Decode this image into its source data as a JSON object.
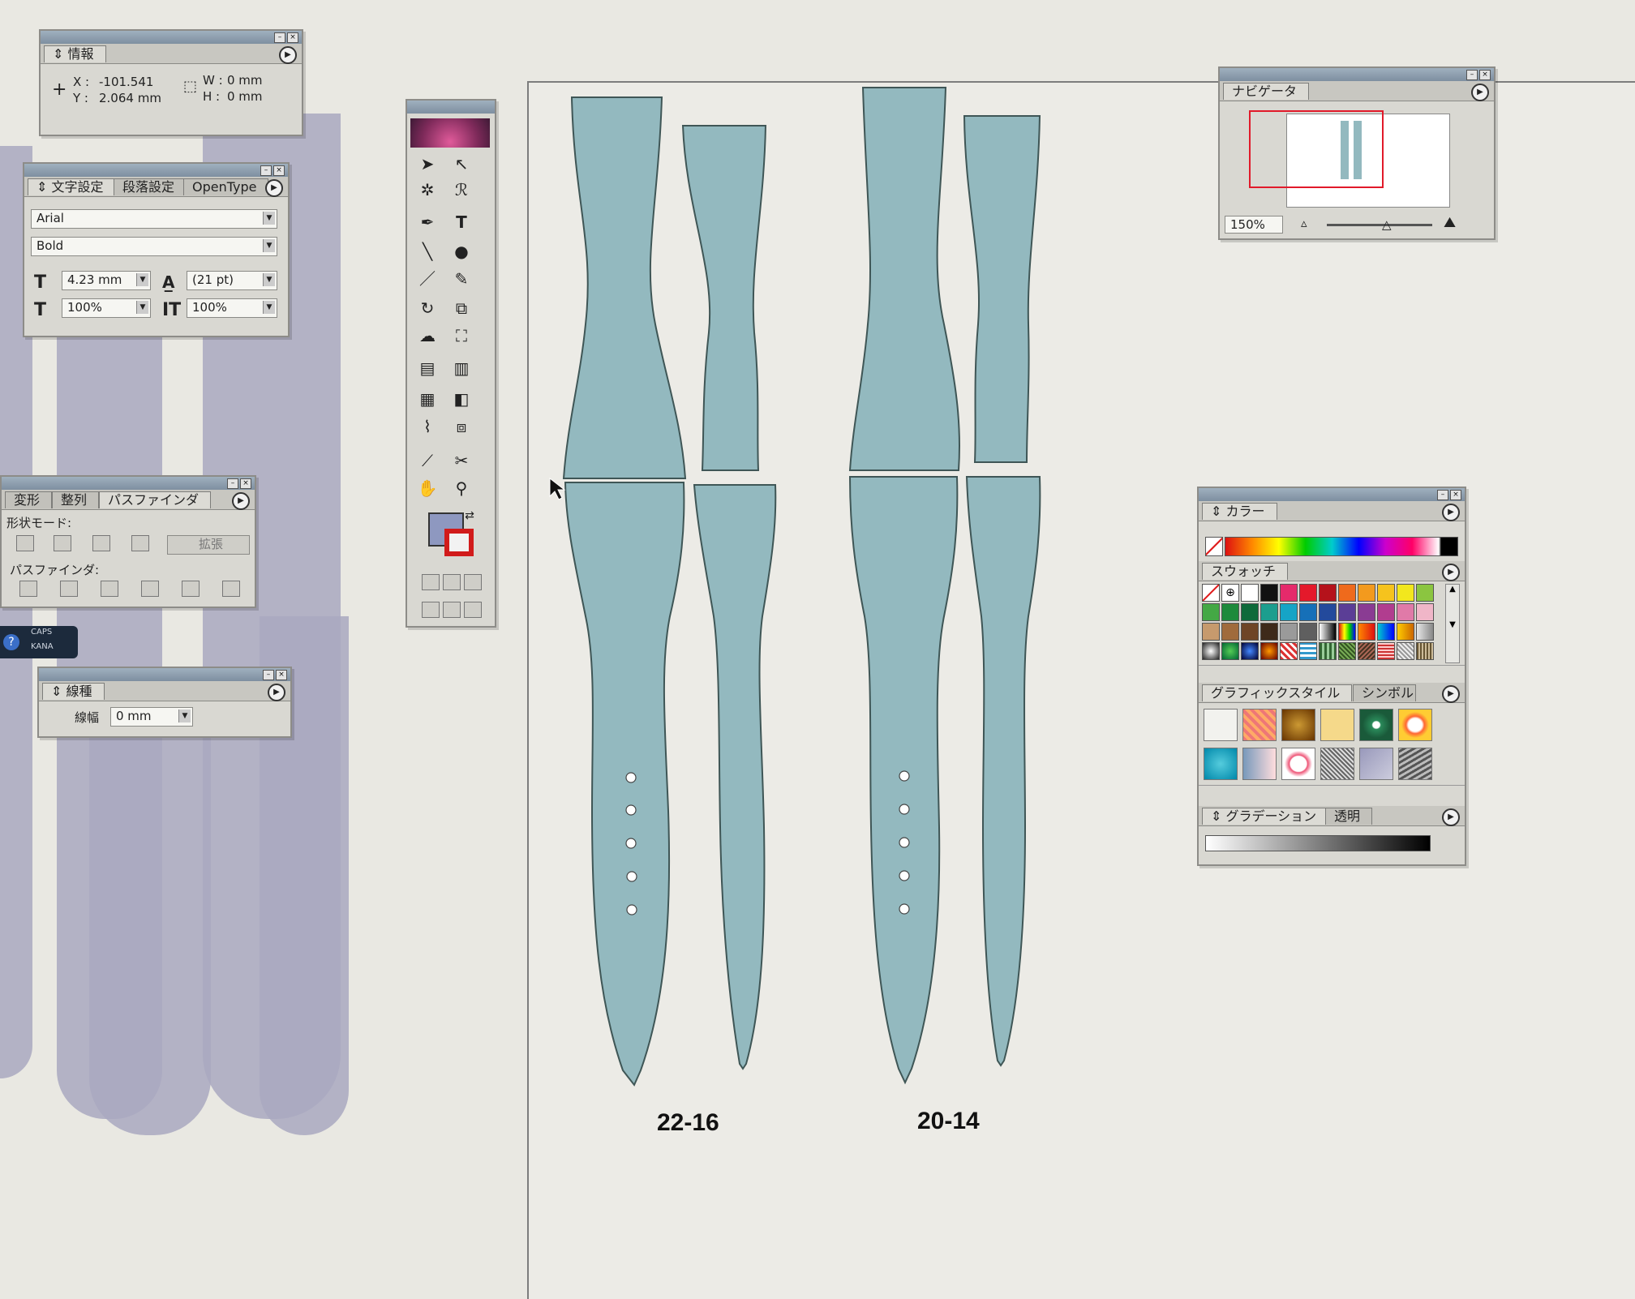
{
  "info_panel": {
    "title": "情報",
    "x_label": "X :",
    "x_value": "-101.541",
    "y_label": "Y :",
    "y_value": "2.064 mm",
    "w_label": "W :",
    "w_value": "0 mm",
    "h_label": "H :",
    "h_value": "0 mm"
  },
  "char_panel": {
    "tabs": [
      "文字設定",
      "段落設定",
      "OpenType"
    ],
    "font": "Arial",
    "style": "Bold",
    "size": "4.23 mm",
    "leading": "(21 pt)",
    "hscale": "100%",
    "vscale": "100%"
  },
  "pathfinder_panel": {
    "tabs": [
      "変形",
      "整列",
      "パスファインダ"
    ],
    "shape_modes_label": "形状モード:",
    "expand_label": "拡張",
    "pathfinders_label": "パスファインダ:"
  },
  "status": {
    "caps": "CAPS",
    "kana": "KANA"
  },
  "stroke_panel": {
    "title": "線種",
    "weight_label": "線幅",
    "weight_value": "0 mm"
  },
  "navigator_panel": {
    "title": "ナビゲータ",
    "zoom": "150%"
  },
  "color_panel": {
    "title": "カラー"
  },
  "swatches_panel": {
    "title": "スウォッチ"
  },
  "graphic_style_panel": {
    "tabs": [
      "グラフィックスタイル",
      "シンボル"
    ]
  },
  "gradient_panel": {
    "tabs": [
      "グラデーション",
      "透明"
    ]
  },
  "artwork": {
    "label_left": "22-16",
    "label_right": "20-14",
    "strap_fill": "#93b9bf",
    "strap_stroke": "#3f5656"
  },
  "icons": [
    "selection-tool-icon",
    "direct-selection-tool-icon",
    "magic-wand-icon",
    "lasso-icon",
    "pen-tool-icon",
    "type-tool-icon",
    "line-tool-icon",
    "ellipse-tool-icon",
    "paintbrush-icon",
    "pencil-icon",
    "rotate-tool-icon",
    "scale-tool-icon",
    "warp-tool-icon",
    "free-transform-icon",
    "symbol-sprayer-icon",
    "graph-tool-icon",
    "mesh-tool-icon",
    "gradient-tool-icon",
    "eyedropper-icon",
    "blend-tool-icon",
    "slice-tool-icon",
    "scissors-icon",
    "hand-tool-icon",
    "zoom-tool-icon"
  ],
  "colors": {
    "fill_swatch": "#8e98c0",
    "stroke_swatch": "#d11b1b",
    "palette_bg": "#d9d8d2",
    "titlebar": "#8796a6"
  }
}
